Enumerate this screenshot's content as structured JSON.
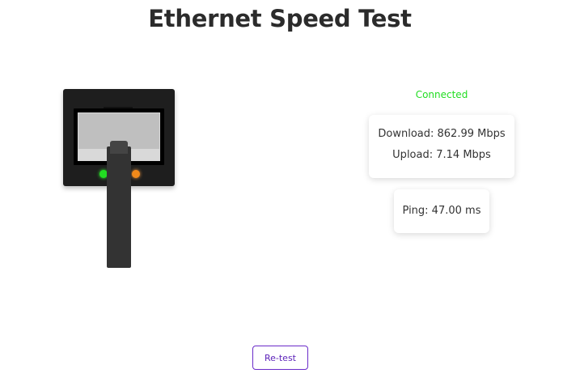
{
  "header": {
    "title": "Ethernet Speed Test"
  },
  "connection": {
    "status": "Connected",
    "status_color": "#22dd22"
  },
  "stats": {
    "download": "Download: 862.99 Mbps",
    "upload": "Upload: 7.14 Mbps",
    "ping": "Ping: 47.00 ms"
  },
  "device": {
    "icon": "ethernet-port-icon",
    "leds": [
      {
        "name": "green-led",
        "color": "#22dd22"
      },
      {
        "name": "orange-led",
        "color": "#f28a1a"
      }
    ]
  },
  "actions": {
    "retest_label": "Re-test"
  },
  "colors": {
    "accent": "#6a2bc9"
  }
}
